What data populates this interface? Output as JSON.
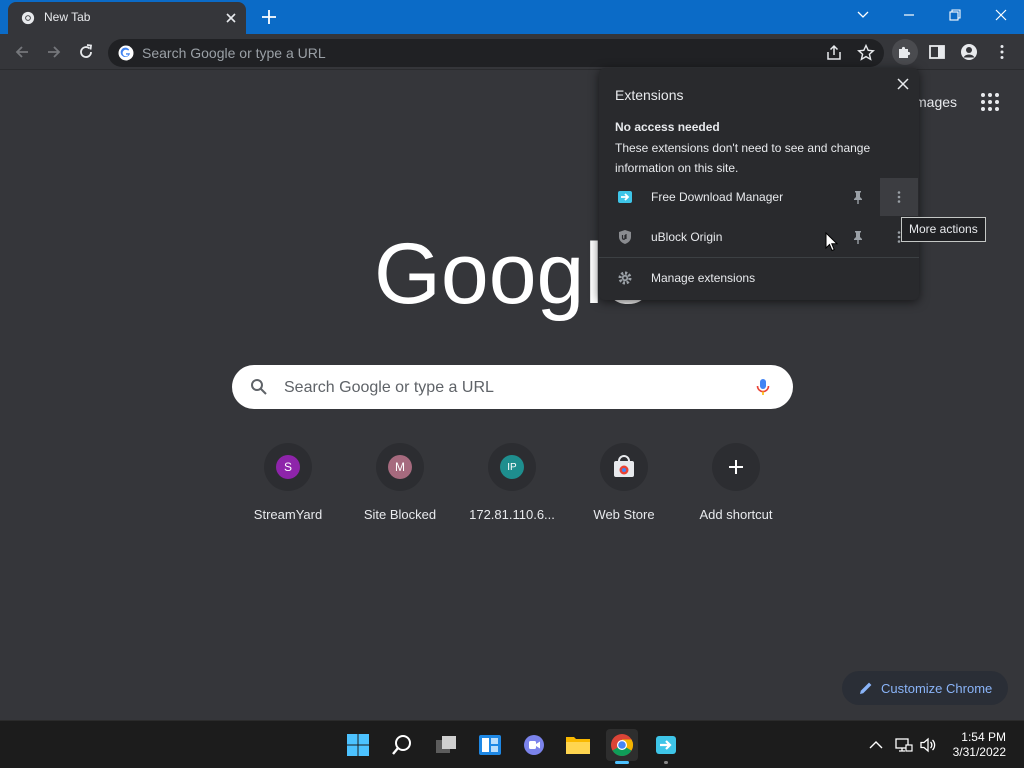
{
  "browser": {
    "tab_title": "New Tab",
    "omnibox_placeholder": "Search Google or type a URL"
  },
  "ntp": {
    "top_link": "Images",
    "top_link_visible": "mages",
    "logo_text": "Google",
    "search_placeholder": "Search Google or type a URL",
    "shortcuts": [
      {
        "letter": "S",
        "label": "StreamYard",
        "color": "#8e24aa"
      },
      {
        "letter": "M",
        "label": "Site Blocked",
        "color": "#a66a7e"
      },
      {
        "letter": "IP",
        "label": "172.81.110.6...",
        "color": "#1e8e8e"
      },
      {
        "letter": "",
        "label": "Web Store",
        "color": ""
      },
      {
        "letter": "+",
        "label": "Add shortcut",
        "color": ""
      }
    ],
    "customize_label": "Customize Chrome"
  },
  "extensions_popup": {
    "title": "Extensions",
    "section_heading": "No access needed",
    "section_description": "These extensions don't need to see and change information on this site.",
    "items": [
      {
        "name": "Free Download Manager",
        "icon": "fdm-icon"
      },
      {
        "name": "uBlock Origin",
        "icon": "ublock-icon"
      }
    ],
    "manage_label": "Manage extensions",
    "tooltip": "More actions"
  },
  "taskbar": {
    "time": "1:54 PM",
    "date": "3/31/2022"
  },
  "colors": {
    "titlebar": "#0b6bc7",
    "page_bg": "#35363a",
    "accent_link": "#8ab4f8"
  }
}
